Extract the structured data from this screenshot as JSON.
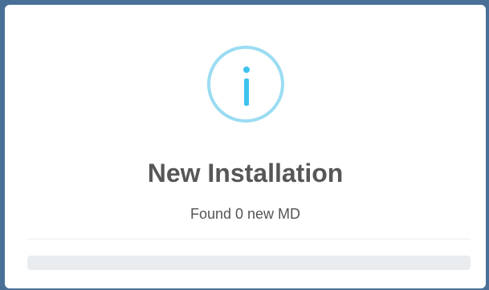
{
  "dialog": {
    "icon": "info-icon",
    "title": "New Installation",
    "message": "Found 0 new MD",
    "progress_fraction": 0
  },
  "colors": {
    "backdrop": "#4a6f97",
    "icon_ring": "#9bdcf2",
    "icon_glyph": "#3fc3ee",
    "title_text": "#575757",
    "progress_track": "#e9ecef"
  }
}
